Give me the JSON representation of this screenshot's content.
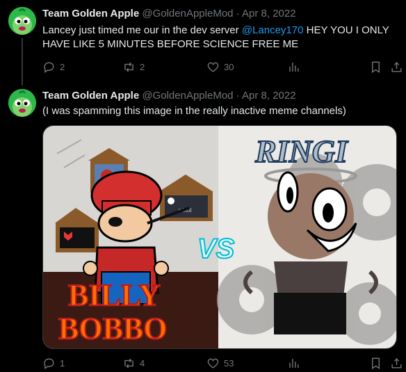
{
  "tweet1": {
    "name": "Team Golden Apple",
    "handle": "@GoldenAppleMod",
    "dot": "·",
    "date": "Apr 8, 2022",
    "text_before": "Lancey just timed me our in the dev server ",
    "mention": "@Lancey170",
    "text_after": " HEY YOU I ONLY HAVE LIKE 5 MINUTES BEFORE SCIENCE FREE ME",
    "replies": "2",
    "retweets": "2",
    "likes": "30"
  },
  "tweet2": {
    "name": "Team Golden Apple",
    "handle": "@GoldenAppleMod",
    "dot": "·",
    "date": "Apr 8, 2022",
    "text": "(I was spamming this image in the really inactive meme channels)",
    "replies": "1",
    "retweets": "4",
    "likes": "53",
    "image": {
      "left_title_line1": "BILLY",
      "left_title_line2": "BOBBO",
      "vs_text": "VS",
      "right_title": "RINGI",
      "frame_small_text": "a loot"
    }
  },
  "icons": [
    "reply-icon",
    "retweet-icon",
    "like-icon",
    "views-icon",
    "bookmark-icon",
    "share-icon"
  ],
  "colors": {
    "background": "#000000",
    "mention": "#1d9bf0",
    "muted": "#71767b",
    "text": "#e7e9ea"
  }
}
